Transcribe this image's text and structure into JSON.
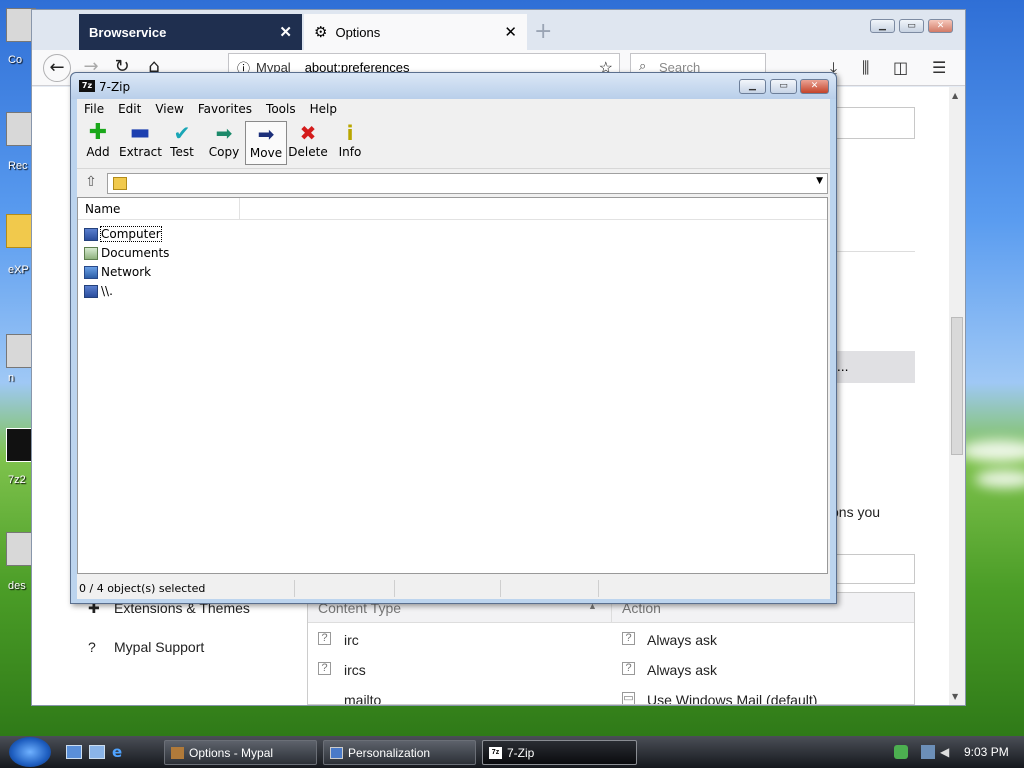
{
  "desktop": {
    "icon_labels": [
      "Co",
      "Rec",
      "eXP",
      "n",
      "7z2",
      "des"
    ]
  },
  "browser": {
    "tabs": [
      {
        "label": "Browservice"
      },
      {
        "label": "Options"
      }
    ],
    "url": {
      "site": "Mypal",
      "address": "about:preferences"
    },
    "search_placeholder": "Search",
    "sidebar": [
      {
        "label": "Extensions & Themes"
      },
      {
        "label": "Mypal Support"
      }
    ],
    "browse_button_fragment": "wse...",
    "paragraph_fragment": "ons you",
    "apps_table": {
      "headers": {
        "content_type": "Content Type",
        "action": "Action"
      },
      "rows": [
        {
          "type": "irc",
          "action": "Always ask"
        },
        {
          "type": "ircs",
          "action": "Always ask"
        },
        {
          "type": "mailto",
          "action": "Use Windows Mail (default)"
        }
      ]
    }
  },
  "sevenzip": {
    "title": "7-Zip",
    "logo_text": "7z",
    "menu": [
      "File",
      "Edit",
      "View",
      "Favorites",
      "Tools",
      "Help"
    ],
    "toolbar": [
      {
        "label": "Add",
        "icon": "plus-icon",
        "color": "#1aa81a"
      },
      {
        "label": "Extract",
        "icon": "minus-icon",
        "color": "#1c3fb0"
      },
      {
        "label": "Test",
        "icon": "check-icon",
        "color": "#19a6b6"
      },
      {
        "label": "Copy",
        "icon": "arrow-right-icon",
        "color": "#1c8a6a"
      },
      {
        "label": "Move",
        "icon": "move-arrow-icon",
        "color": "#1c2f7a"
      },
      {
        "label": "Delete",
        "icon": "x-icon",
        "color": "#d41c1c"
      },
      {
        "label": "Info",
        "icon": "info-icon",
        "color": "#d9c400"
      }
    ],
    "address_value": "",
    "list": {
      "column_name": "Name",
      "items": [
        {
          "name": "Computer",
          "icon": "computer-icon",
          "selected": true
        },
        {
          "name": "Documents",
          "icon": "documents-icon",
          "selected": false
        },
        {
          "name": "Network",
          "icon": "network-icon",
          "selected": false
        },
        {
          "name": "\\\\.",
          "icon": "computer-icon",
          "selected": false
        }
      ]
    },
    "status": "0 / 4 object(s) selected"
  },
  "taskbar": {
    "tasks": [
      {
        "label": "Options - Mypal"
      },
      {
        "label": "Personalization"
      },
      {
        "label": "7-Zip"
      }
    ],
    "clock": "9:03 PM"
  }
}
